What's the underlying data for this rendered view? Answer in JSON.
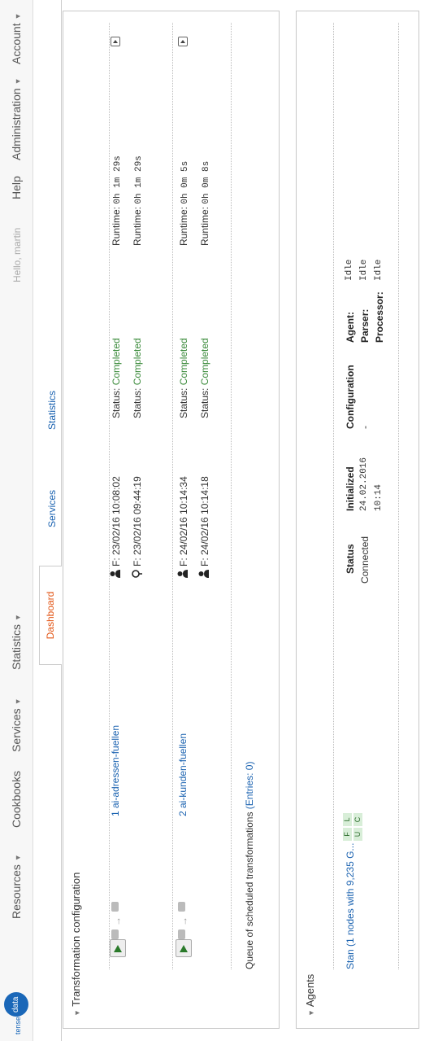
{
  "nav": {
    "brand_a": "tensei",
    "brand_b": "data",
    "resources": "Resources",
    "cookbooks": "Cookbooks",
    "services": "Services",
    "statistics": "Statistics",
    "greeting": "Hello, martin",
    "help": "Help",
    "administration": "Administration",
    "account": "Account"
  },
  "tabs": {
    "dashboard": "Dashboard",
    "services": "Services",
    "statistics": "Statistics"
  },
  "transformation": {
    "heading": "Transformation configuration",
    "items": [
      {
        "name": "1 ai-adressen-fuellen",
        "runs": [
          {
            "from": "F: 23/02/16 10:08:02",
            "status_label": "Status:",
            "status": "Completed",
            "runtime_label": "Runtime:",
            "runtime": "0h 1m 29s"
          },
          {
            "from": "F: 23/02/16 09:44:19",
            "status_label": "Status:",
            "status": "Completed",
            "runtime_label": "Runtime:",
            "runtime": "0h 1m 29s"
          }
        ]
      },
      {
        "name": "2 ai-kunden-fuellen",
        "runs": [
          {
            "from": "F: 24/02/16 10:14:34",
            "status_label": "Status:",
            "status": "Completed",
            "runtime_label": "Runtime:",
            "runtime": "0h 0m 5s"
          },
          {
            "from": "F: 24/02/16 10:14:18",
            "status_label": "Status:",
            "status": "Completed",
            "runtime_label": "Runtime:",
            "runtime": "0h 0m 8s"
          }
        ]
      }
    ],
    "queue_label": "Queue of scheduled transformations",
    "queue_entries": "(Entries: 0)"
  },
  "agents": {
    "heading": "Agents",
    "name": "Stan",
    "desc": "(1 nodes with 9,235 G...",
    "badges": [
      "F",
      "L",
      "U",
      "C"
    ],
    "status_header": "Status",
    "status": "Connected",
    "initialized_header": "Initialized",
    "initialized_date": "24.02.2016",
    "initialized_time": "10:14",
    "configuration_header": "Configuration",
    "configuration": "-",
    "agent_label": "Agent:",
    "agent_value": "Idle",
    "parser_label": "Parser:",
    "parser_value": "Idle",
    "processor_label": "Processor:",
    "processor_value": "Idle"
  }
}
